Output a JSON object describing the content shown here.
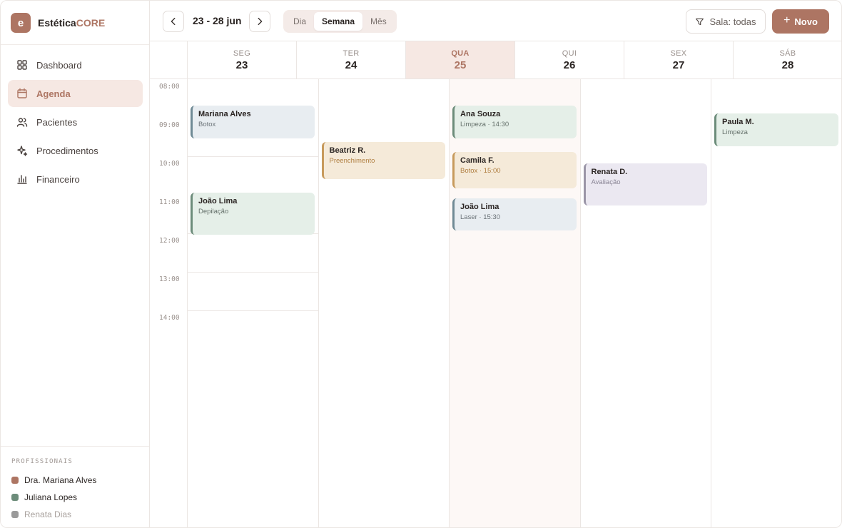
{
  "brand": {
    "logo_letter": "e",
    "name_main": "Estética",
    "name_accent": "CORE"
  },
  "nav": [
    {
      "label": "Dashboard",
      "icon": "grid-icon",
      "active": false
    },
    {
      "label": "Agenda",
      "icon": "calendar-icon",
      "active": true
    },
    {
      "label": "Pacientes",
      "icon": "users-icon",
      "active": false
    },
    {
      "label": "Procedimentos",
      "icon": "sparkle-icon",
      "active": false
    },
    {
      "label": "Financeiro",
      "icon": "bar-chart-icon",
      "active": false
    }
  ],
  "professionals": {
    "title": "PROFISSIONAIS",
    "items": [
      {
        "name": "Dra. Mariana Alves",
        "color": "#ad7563",
        "muted": false
      },
      {
        "name": "Juliana Lopes",
        "color": "#6c8c7a",
        "muted": false
      },
      {
        "name": "Renata Dias",
        "color": "#9a9a9a",
        "muted": true
      }
    ]
  },
  "toolbar": {
    "date_range": "23 - 28 jun",
    "views": [
      "Dia",
      "Semana",
      "Mês"
    ],
    "active_view": "Semana",
    "filter_label": "Sala: todas",
    "new_label": "Novo"
  },
  "days": [
    {
      "name": "SEG",
      "num": "23",
      "today": false
    },
    {
      "name": "TER",
      "num": "24",
      "today": false
    },
    {
      "name": "QUA",
      "num": "25",
      "today": true
    },
    {
      "name": "QUI",
      "num": "26",
      "today": false
    },
    {
      "name": "SEX",
      "num": "27",
      "today": false
    },
    {
      "name": "SÁB",
      "num": "28",
      "today": false
    }
  ],
  "hours": [
    "08:00",
    "09:00",
    "10:00",
    "11:00",
    "12:00",
    "13:00",
    "14:00"
  ],
  "events": [
    {
      "day": 0,
      "name": "Mariana Alves",
      "sub": "Botox",
      "color": "blue",
      "start": 8.5,
      "end": 9.35
    },
    {
      "day": 0,
      "name": "João Lima",
      "sub": "Depilação",
      "color": "green",
      "start": 10.75,
      "end": 11.85
    },
    {
      "day": 1,
      "name": "Beatriz R.",
      "sub": "Preenchimento",
      "color": "sand",
      "start": 9.45,
      "end": 10.4
    },
    {
      "day": 2,
      "name": "Ana Souza",
      "sub": "Limpeza · 14:30",
      "color": "green",
      "start": 8.5,
      "end": 9.35
    },
    {
      "day": 2,
      "name": "Camila F.",
      "sub": "Botox · 15:00",
      "color": "sand",
      "start": 9.7,
      "end": 10.65
    },
    {
      "day": 2,
      "name": "João Lima",
      "sub": "Laser · 15:30",
      "color": "blue",
      "start": 10.9,
      "end": 11.75
    },
    {
      "day": 3,
      "name": "Renata D.",
      "sub": "Avaliação",
      "color": "lav",
      "start": 10.0,
      "end": 11.1
    },
    {
      "day": 4,
      "name": "Paula M.",
      "sub": "Limpeza",
      "color": "green",
      "start": 8.7,
      "end": 9.55
    }
  ]
}
